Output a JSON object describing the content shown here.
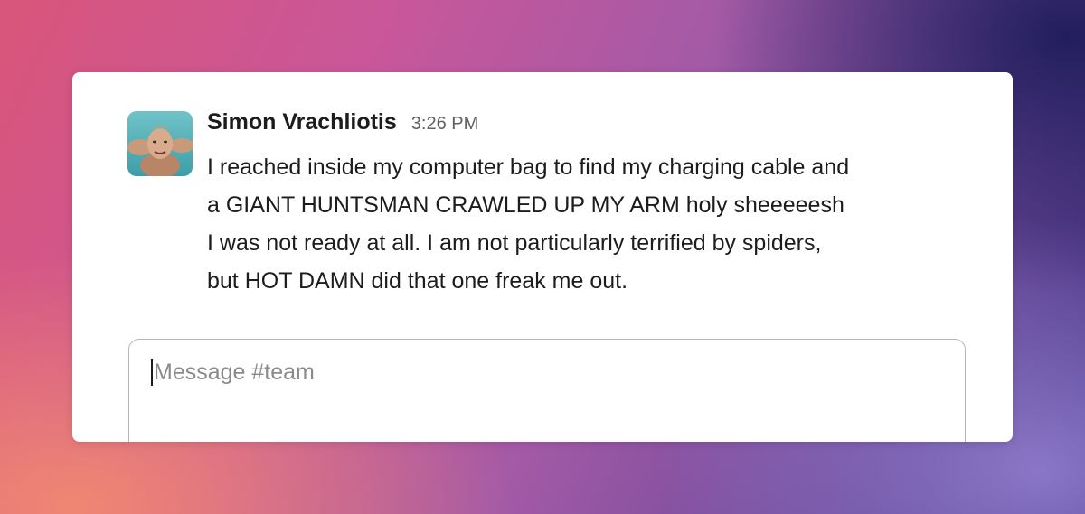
{
  "message": {
    "author": "Simon Vrachliotis",
    "timestamp": "3:26 PM",
    "text": "I reached inside my computer bag to find my charging cable and\na GIANT HUNTSMAN CRAWLED UP MY ARM holy sheeeeesh\nI was not ready at all. I am not particularly terrified by spiders,\nbut HOT DAMN did that one freak me out.",
    "avatar_icon": "user-avatar-photo"
  },
  "composer": {
    "placeholder": "Message #team"
  },
  "colors": {
    "author_text": "#1d1c1d",
    "timestamp_text": "#616061",
    "placeholder_text": "#8a8a8a",
    "card_background": "#ffffff"
  }
}
